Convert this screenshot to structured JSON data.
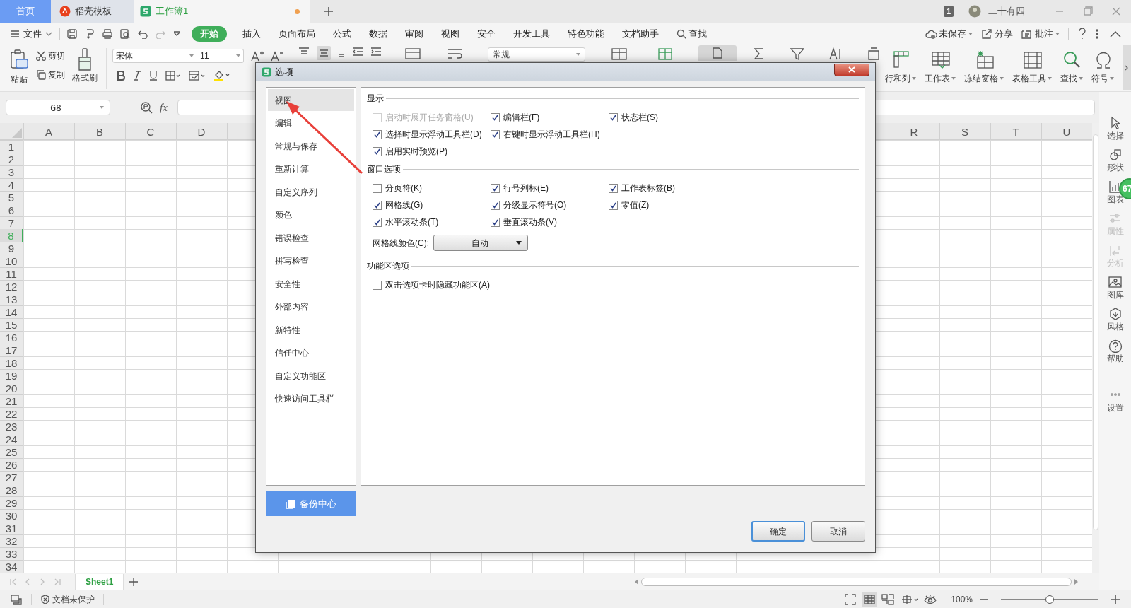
{
  "tabs": [
    {
      "label": "首页",
      "kind": "home",
      "selected": false,
      "modified": false
    },
    {
      "label": "稻壳模板",
      "kind": "docer",
      "selected": false,
      "modified": false
    },
    {
      "label": "工作簿1",
      "kind": "sheet",
      "selected": true,
      "modified": true
    }
  ],
  "account": {
    "badge": "1",
    "user": "二十有四"
  },
  "menu": {
    "file": "文件",
    "search": "查找",
    "tabs": [
      {
        "label": "开始",
        "selected": true
      },
      {
        "label": "插入",
        "selected": false
      },
      {
        "label": "页面布局",
        "selected": false
      },
      {
        "label": "公式",
        "selected": false
      },
      {
        "label": "数据",
        "selected": false
      },
      {
        "label": "审阅",
        "selected": false
      },
      {
        "label": "视图",
        "selected": false
      },
      {
        "label": "安全",
        "selected": false
      },
      {
        "label": "开发工具",
        "selected": false
      },
      {
        "label": "特色功能",
        "selected": false
      },
      {
        "label": "文档助手",
        "selected": false
      }
    ],
    "actions": [
      {
        "label": "未保存",
        "kind": "cloud"
      },
      {
        "label": "分享",
        "kind": "share"
      },
      {
        "label": "批注",
        "kind": "comment"
      }
    ]
  },
  "ribbon": {
    "paste": "粘贴",
    "cut": "剪切",
    "copy": "复制",
    "painter": "格式刷",
    "font": "宋体",
    "size": "11",
    "number_format": "常规",
    "tools": [
      {
        "label": "行和列",
        "kind": "rowcol"
      },
      {
        "label": "工作表",
        "kind": "sheet"
      },
      {
        "label": "冻结窗格",
        "kind": "freeze"
      },
      {
        "label": "表格工具",
        "kind": "tabletools"
      },
      {
        "label": "查找",
        "kind": "find"
      },
      {
        "label": "符号",
        "kind": "symbol"
      }
    ]
  },
  "formula_bar": {
    "cell": "G8",
    "fx": "fx"
  },
  "grid": {
    "columns_left": [
      "A",
      "B",
      "C",
      "D"
    ],
    "columns_right": [
      "R",
      "S",
      "T",
      "U"
    ],
    "rows": [
      {
        "label": "1",
        "selected": false
      },
      {
        "label": "2",
        "selected": false
      },
      {
        "label": "3",
        "selected": false
      },
      {
        "label": "4",
        "selected": false
      },
      {
        "label": "5",
        "selected": false
      },
      {
        "label": "6",
        "selected": false
      },
      {
        "label": "7",
        "selected": false
      },
      {
        "label": "8",
        "selected": true
      },
      {
        "label": "9",
        "selected": false
      },
      {
        "label": "10",
        "selected": false
      },
      {
        "label": "11",
        "selected": false
      },
      {
        "label": "12",
        "selected": false
      },
      {
        "label": "13",
        "selected": false
      },
      {
        "label": "14",
        "selected": false
      },
      {
        "label": "15",
        "selected": false
      },
      {
        "label": "16",
        "selected": false
      },
      {
        "label": "17",
        "selected": false
      },
      {
        "label": "18",
        "selected": false
      },
      {
        "label": "19",
        "selected": false
      },
      {
        "label": "20",
        "selected": false
      },
      {
        "label": "21",
        "selected": false
      },
      {
        "label": "22",
        "selected": false
      },
      {
        "label": "23",
        "selected": false
      },
      {
        "label": "24",
        "selected": false
      },
      {
        "label": "25",
        "selected": false
      },
      {
        "label": "26",
        "selected": false
      },
      {
        "label": "27",
        "selected": false
      },
      {
        "label": "28",
        "selected": false
      },
      {
        "label": "29",
        "selected": false
      },
      {
        "label": "30",
        "selected": false
      },
      {
        "label": "31",
        "selected": false
      },
      {
        "label": "32",
        "selected": false
      },
      {
        "label": "33",
        "selected": false
      },
      {
        "label": "34",
        "selected": false
      }
    ]
  },
  "sheet_tabs": [
    {
      "label": "Sheet1",
      "selected": true
    }
  ],
  "side_panel": [
    {
      "label": "选择",
      "kind": "select",
      "disabled": false
    },
    {
      "label": "形状",
      "kind": "shape",
      "disabled": false
    },
    {
      "label": "图表",
      "kind": "chart",
      "disabled": false
    },
    {
      "label": "属性",
      "kind": "props",
      "disabled": true
    },
    {
      "label": "分析",
      "kind": "analyze",
      "disabled": true
    },
    {
      "label": "图库",
      "kind": "gallery",
      "disabled": false
    },
    {
      "label": "风格",
      "kind": "style",
      "disabled": false
    },
    {
      "label": "帮助",
      "kind": "help",
      "disabled": false
    },
    {
      "label": "设置",
      "kind": "settings",
      "disabled": false
    }
  ],
  "notification": {
    "count": "67"
  },
  "status_bar": {
    "protect": "文档未保护",
    "zoom": "100%",
    "zoom_slider": {
      "level": 0.5
    }
  },
  "dialog": {
    "title": "选项",
    "nav": [
      {
        "label": "视图",
        "selected": true
      },
      {
        "label": "编辑",
        "selected": false
      },
      {
        "label": "常规与保存",
        "selected": false
      },
      {
        "label": "重新计算",
        "selected": false
      },
      {
        "label": "自定义序列",
        "selected": false
      },
      {
        "label": "颜色",
        "selected": false
      },
      {
        "label": "错误检查",
        "selected": false
      },
      {
        "label": "拼写检查",
        "selected": false
      },
      {
        "label": "安全性",
        "selected": false
      },
      {
        "label": "外部内容",
        "selected": false
      },
      {
        "label": "新特性",
        "selected": false
      },
      {
        "label": "信任中心",
        "selected": false
      },
      {
        "label": "自定义功能区",
        "selected": false
      },
      {
        "label": "快速访问工具栏",
        "selected": false
      }
    ],
    "backup": "备份中心",
    "sections": [
      {
        "title": "显示",
        "rows": [
          [
            {
              "label": "启动时展开任务窗格(U)",
              "checked": false,
              "disabled": true
            },
            {
              "label": "编辑栏(F)",
              "checked": true,
              "disabled": false
            },
            {
              "label": "状态栏(S)",
              "checked": true,
              "disabled": false
            }
          ],
          [
            {
              "label": "选择时显示浮动工具栏(D)",
              "checked": true,
              "disabled": false
            },
            {
              "label": "右键时显示浮动工具栏(H)",
              "checked": true,
              "disabled": false
            }
          ],
          [
            {
              "label": "启用实时预览(P)",
              "checked": true,
              "disabled": false
            }
          ]
        ]
      },
      {
        "title": "窗口选项",
        "rows": [
          [
            {
              "label": "分页符(K)",
              "checked": false,
              "disabled": false
            },
            {
              "label": "行号列标(E)",
              "checked": true,
              "disabled": false
            },
            {
              "label": "工作表标签(B)",
              "checked": true,
              "disabled": false
            }
          ],
          [
            {
              "label": "网格线(G)",
              "checked": true,
              "disabled": false
            },
            {
              "label": "分级显示符号(O)",
              "checked": true,
              "disabled": false
            },
            {
              "label": "零值(Z)",
              "checked": true,
              "disabled": false
            }
          ],
          [
            {
              "label": "水平滚动条(T)",
              "checked": true,
              "disabled": false
            },
            {
              "label": "垂直滚动条(V)",
              "checked": true,
              "disabled": false
            }
          ]
        ],
        "select": {
          "label": "网格线颜色(C):",
          "value": "自动"
        }
      },
      {
        "title": "功能区选项",
        "rows": [
          [
            {
              "label": "双击选项卡时隐藏功能区(A)",
              "checked": false,
              "disabled": false
            }
          ]
        ]
      }
    ],
    "buttons": [
      {
        "label": "确定",
        "kind": "primary"
      },
      {
        "label": "取消",
        "kind": "secondary"
      }
    ]
  },
  "annotation": {
    "kind": "arrow"
  }
}
